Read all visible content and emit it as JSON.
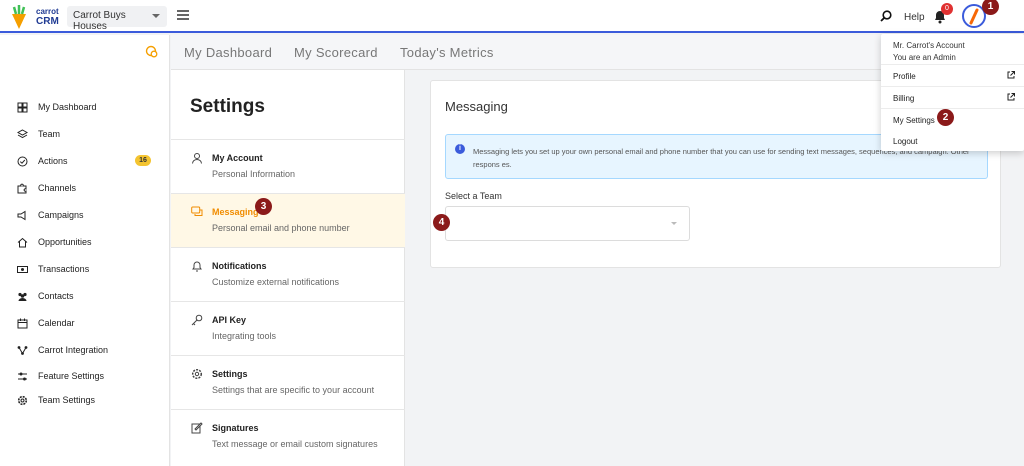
{
  "header": {
    "brand_small": "carrot",
    "brand_big": "CRM",
    "team_selected": "Carrot Buys Houses",
    "help_label": "Help",
    "notification_count": "0"
  },
  "steps": {
    "s1": "1",
    "s2": "2",
    "s3": "3",
    "s4": "4"
  },
  "sidebar": {
    "items": [
      {
        "label": "My Dashboard",
        "icon": "dashboard-icon"
      },
      {
        "label": "Team",
        "icon": "layers-icon"
      },
      {
        "label": "Actions",
        "icon": "check-circle-icon",
        "count": "16"
      },
      {
        "label": "Channels",
        "icon": "puzzle-icon"
      },
      {
        "label": "Campaigns",
        "icon": "megaphone-icon"
      },
      {
        "label": "Opportunities",
        "icon": "home-icon"
      },
      {
        "label": "Transactions",
        "icon": "money-icon"
      },
      {
        "label": "Contacts",
        "icon": "users-icon"
      },
      {
        "label": "Calendar",
        "icon": "calendar-icon"
      },
      {
        "label": "Carrot Integration",
        "icon": "integration-icon"
      },
      {
        "label": "Feature Settings",
        "icon": "sliders-icon"
      },
      {
        "label": "Team Settings",
        "icon": "gear-icon"
      }
    ]
  },
  "tabs": [
    "My Dashboard",
    "My Scorecard",
    "Today's Metrics"
  ],
  "settings": {
    "title": "Settings",
    "items": [
      {
        "title": "My Account",
        "subtitle": "Personal Information"
      },
      {
        "title": "Messaging",
        "subtitle": "Personal email and phone number"
      },
      {
        "title": "Notifications",
        "subtitle": "Customize external notifications"
      },
      {
        "title": "API Key",
        "subtitle": "Integrating tools"
      },
      {
        "title": "Settings",
        "subtitle": "Settings that are specific to your account"
      },
      {
        "title": "Signatures",
        "subtitle": "Text message or email custom signatures"
      }
    ]
  },
  "messaging": {
    "title": "Messaging",
    "info": "Messaging lets you set up your own personal email and phone number that you can use for sending text messages, sequences, and campaign. Other respons es.",
    "select_label": "Select a Team",
    "select_value": ""
  },
  "account_menu": {
    "name": "Mr. Carrot's Account",
    "role": "You are an Admin",
    "items": [
      "Profile",
      "Billing",
      "My Settings",
      "Logout"
    ]
  },
  "colors": {
    "accent": "#3b5bdb",
    "active": "#f08c00",
    "step_marker": "#8b1a1a",
    "badge": "#e03131"
  }
}
